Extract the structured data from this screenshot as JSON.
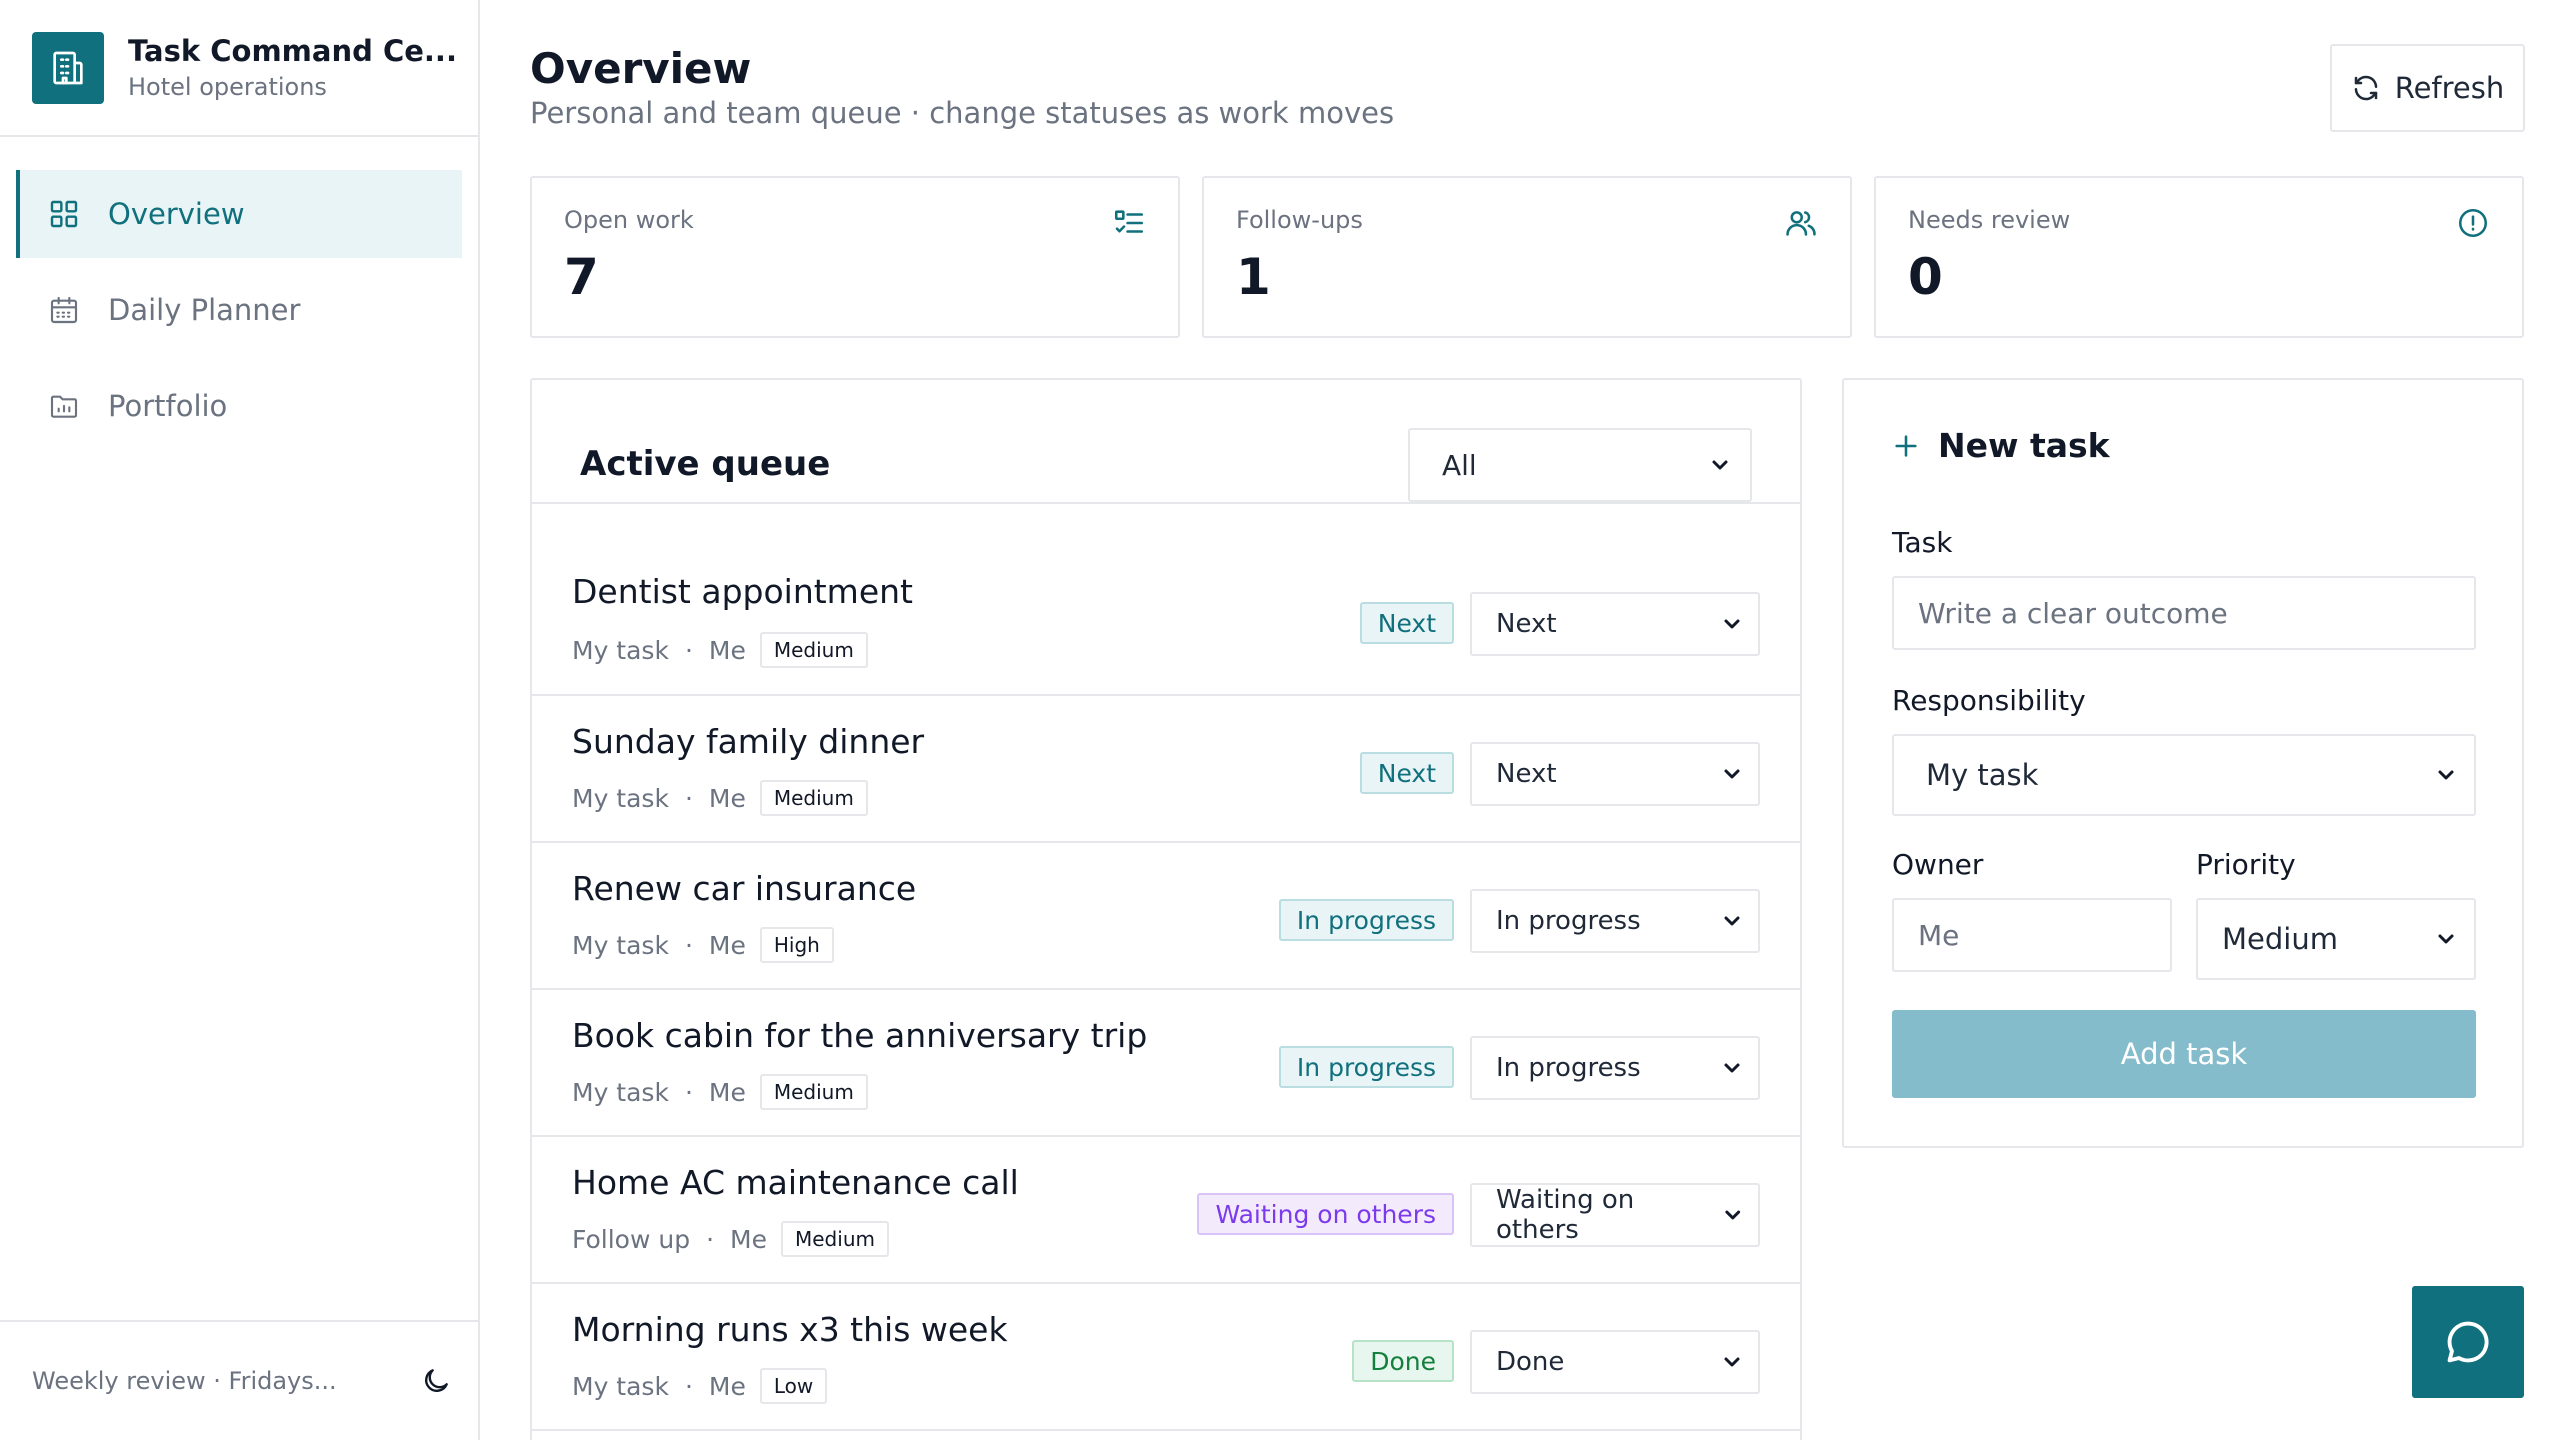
{
  "app": {
    "title": "Task Command Ce...",
    "subtitle": "Hotel operations"
  },
  "nav": [
    {
      "label": "Overview",
      "icon": "grid-icon",
      "active": true
    },
    {
      "label": "Daily Planner",
      "icon": "calendar-icon",
      "active": false
    },
    {
      "label": "Portfolio",
      "icon": "folder-chart-icon",
      "active": false
    }
  ],
  "footer": {
    "text": "Weekly review · Fridays..."
  },
  "header": {
    "title": "Overview",
    "subtitle": "Personal and team queue · change statuses as work moves",
    "refresh_label": "Refresh"
  },
  "stats": [
    {
      "label": "Open work",
      "value": "7",
      "icon": "checklist-icon"
    },
    {
      "label": "Follow-ups",
      "value": "1",
      "icon": "users-icon"
    },
    {
      "label": "Needs review",
      "value": "0",
      "icon": "alert-circle-icon"
    }
  ],
  "queue": {
    "title": "Active queue",
    "filter_value": "All",
    "tasks": [
      {
        "title": "Dentist appointment",
        "type": "My task",
        "owner": "Me",
        "priority": "Medium",
        "status": "Next"
      },
      {
        "title": "Sunday family dinner",
        "type": "My task",
        "owner": "Me",
        "priority": "Medium",
        "status": "Next"
      },
      {
        "title": "Renew car insurance",
        "type": "My task",
        "owner": "Me",
        "priority": "High",
        "status": "In progress"
      },
      {
        "title": "Book cabin for the anniversary trip",
        "type": "My task",
        "owner": "Me",
        "priority": "Medium",
        "status": "In progress"
      },
      {
        "title": "Home AC maintenance call",
        "type": "Follow up",
        "owner": "Me",
        "priority": "Medium",
        "status": "Waiting on others"
      },
      {
        "title": "Morning runs x3 this week",
        "type": "My task",
        "owner": "Me",
        "priority": "Low",
        "status": "Done"
      }
    ]
  },
  "new_task": {
    "title": "New task",
    "task_label": "Task",
    "task_placeholder": "Write a clear outcome",
    "responsibility_label": "Responsibility",
    "responsibility_value": "My task",
    "owner_label": "Owner",
    "owner_placeholder": "Me",
    "priority_label": "Priority",
    "priority_value": "Medium",
    "add_label": "Add task"
  },
  "colors": {
    "accent": "#11707d",
    "accent_soft": "#e8f4f5",
    "add_button": "#84bccb",
    "waiting": "#7c3aed",
    "done": "#15803d"
  }
}
